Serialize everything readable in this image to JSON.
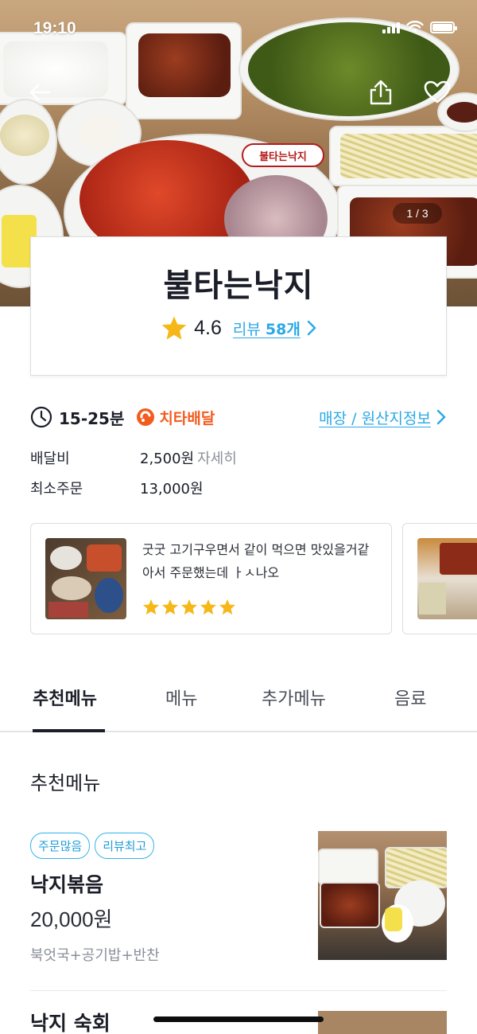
{
  "status_bar": {
    "time": "19:10"
  },
  "hero": {
    "pager": "1 / 3",
    "logo_text": "불타는낙지"
  },
  "store": {
    "name": "불타는낙지",
    "rating": "4.6",
    "review_prefix": "리뷰 ",
    "review_count": "58개"
  },
  "delivery": {
    "time": "15-25분",
    "partner": "치타배달",
    "store_origin_link": "매장 / 원산지정보",
    "fee_label": "배달비",
    "fee_value": "2,500원",
    "fee_detail": "자세히",
    "min_order_label": "최소주문",
    "min_order_value": "13,000원"
  },
  "reviews": [
    {
      "text": "굿굿 고기구우면서 같이 먹으면 맛있을거같아서 주문했는데 ㅏㅅ나오",
      "stars": 5
    },
    {
      "text": "",
      "stars": 0
    }
  ],
  "tabs": [
    {
      "label": "추천메뉴",
      "active": true
    },
    {
      "label": "메뉴"
    },
    {
      "label": "추가메뉴"
    },
    {
      "label": "음료"
    }
  ],
  "menu": {
    "section_title": "추천메뉴",
    "items": [
      {
        "badges": [
          "주문많음",
          "리뷰최고"
        ],
        "name": "낙지볶음",
        "price": "20,000원",
        "desc": "북엇국+공기밥+반찬"
      },
      {
        "name": "낙지 숙회"
      }
    ]
  },
  "colors": {
    "accent_blue": "#2aa8e6",
    "brand_orange": "#f25c1f",
    "star_yellow": "#f5b818",
    "text_dark": "#1b1e28"
  }
}
